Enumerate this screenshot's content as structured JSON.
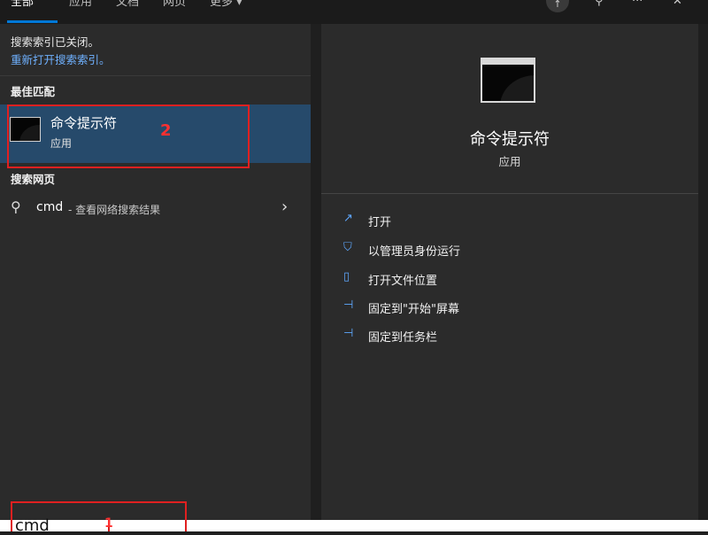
{
  "tabs": [
    {
      "label": "全部"
    },
    {
      "label": "应用"
    },
    {
      "label": "文档"
    },
    {
      "label": "网页"
    },
    {
      "label": "更多 ▾"
    }
  ],
  "notice": {
    "line1": "搜索索引已关闭。",
    "line2": "重新打开搜索索引。"
  },
  "best_match": {
    "heading": "最佳匹配",
    "title": "命令提示符",
    "subtitle": "应用",
    "annotation": "2"
  },
  "web": {
    "heading": "搜索网页",
    "query": "cmd",
    "desc": "- 查看网络搜索结果"
  },
  "detail": {
    "title": "命令提示符",
    "subtitle": "应用",
    "actions": [
      {
        "icon": "open-icon",
        "label": "打开"
      },
      {
        "icon": "shield-icon",
        "label": "以管理员身份运行"
      },
      {
        "icon": "folder-icon",
        "label": "打开文件位置"
      },
      {
        "icon": "pin-icon",
        "label": "固定到\"开始\"屏幕"
      },
      {
        "icon": "pin-icon",
        "label": "固定到任务栏"
      }
    ]
  },
  "search": {
    "value": "cmd",
    "annotation": "1"
  },
  "colors": {
    "accent": "#0078d7",
    "link": "#6fb1ff",
    "selected_bg": "#264a6b",
    "annotation_red": "#e02020"
  }
}
